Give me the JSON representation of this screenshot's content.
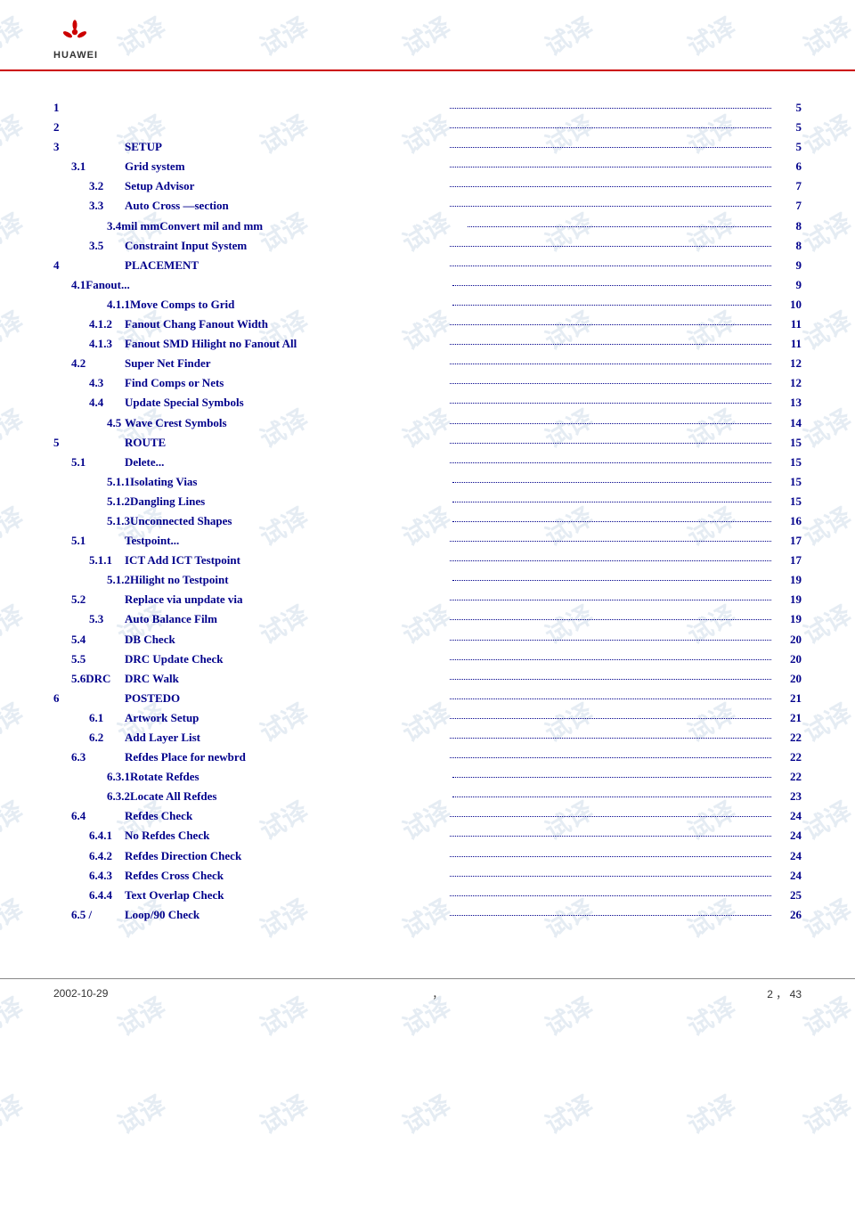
{
  "header": {
    "logo_text": "HUAWEI",
    "logo_alt": "Huawei logo"
  },
  "toc": {
    "entries": [
      {
        "number": "1",
        "title": "",
        "dots": true,
        "page": "5",
        "indent": 1
      },
      {
        "number": "2",
        "title": "",
        "dots": true,
        "page": "5",
        "indent": 1
      },
      {
        "number": "3",
        "title": "SETUP",
        "dots": true,
        "page": "5",
        "indent": 1
      },
      {
        "number": "3.1",
        "title": "Grid system",
        "dots": true,
        "page": "6",
        "indent": 2
      },
      {
        "number": "3.2",
        "title": "Setup Advisor",
        "dots": true,
        "page": "7",
        "indent": 3
      },
      {
        "number": "3.3",
        "title": "Auto Cross —section",
        "dots": true,
        "page": "7",
        "indent": 3
      },
      {
        "number": "3.4mil  mm",
        "title": "Convert mil and mm",
        "dots": true,
        "page": "8",
        "indent": 4
      },
      {
        "number": "3.5",
        "title": "Constraint Input System",
        "dots": true,
        "page": "8",
        "indent": 3
      },
      {
        "number": "4",
        "title": "PLACEMENT",
        "dots": true,
        "page": "9",
        "indent": 1
      },
      {
        "number": "4.1Fanout...",
        "title": "",
        "dots": true,
        "page": "9",
        "indent": 2
      },
      {
        "number": "4.1.1",
        "title": "Move Comps to Grid",
        "dots": true,
        "page": "10",
        "indent": 4
      },
      {
        "number": "4.1.2",
        "title": "Fanout   Chang Fanout Width",
        "dots": true,
        "page": "11",
        "indent": 3
      },
      {
        "number": "4.1.3",
        "title": "Fanout SMD Hilight no Fanout All",
        "dots": true,
        "page": "11",
        "indent": 3
      },
      {
        "number": "4.2",
        "title": "Super Net Finder",
        "dots": true,
        "page": "12",
        "indent": 2
      },
      {
        "number": "4.3",
        "title": "Find Comps or Nets",
        "dots": true,
        "page": "12",
        "indent": 3
      },
      {
        "number": "4.4",
        "title": "Update Special Symbols",
        "dots": true,
        "page": "13",
        "indent": 3
      },
      {
        "number": "4.5",
        "title": "Wave Crest Symbols",
        "dots": true,
        "page": "14",
        "indent": 4
      },
      {
        "number": "5",
        "title": "ROUTE",
        "dots": true,
        "page": "15",
        "indent": 1
      },
      {
        "number": "5.1",
        "title": "Delete...",
        "dots": true,
        "page": "15",
        "indent": 2
      },
      {
        "number": "5.1.1",
        "title": "Isolating Vias",
        "dots": true,
        "page": "15",
        "indent": 4
      },
      {
        "number": "5.1.2",
        "title": "Dangling Lines",
        "dots": true,
        "page": "15",
        "indent": 4
      },
      {
        "number": "5.1.3",
        "title": "Unconnected Shapes",
        "dots": true,
        "page": "16",
        "indent": 4
      },
      {
        "number": "5.1",
        "title": "Testpoint...",
        "dots": true,
        "page": "17",
        "indent": 2
      },
      {
        "number": "5.1.1",
        "title": "ICT    Add ICT Testpoint",
        "dots": true,
        "page": "17",
        "indent": 3
      },
      {
        "number": "5.1.2",
        "title": "Hilight no Testpoint",
        "dots": true,
        "page": "19",
        "indent": 4
      },
      {
        "number": "5.2",
        "title": "Replace via  unpdate via",
        "dots": true,
        "page": "19",
        "indent": 2
      },
      {
        "number": "5.3",
        "title": "Auto Balance Film",
        "dots": true,
        "page": "19",
        "indent": 3
      },
      {
        "number": "5.4",
        "title": "DB Check",
        "dots": true,
        "page": "20",
        "indent": 2
      },
      {
        "number": "5.5",
        "title": "DRC Update Check",
        "dots": true,
        "page": "20",
        "indent": 2
      },
      {
        "number": "5.6DRC",
        "title": "DRC Walk",
        "dots": true,
        "page": "20",
        "indent": 2
      },
      {
        "number": "6",
        "title": "POSTEDO",
        "dots": true,
        "page": "21",
        "indent": 1
      },
      {
        "number": "6.1",
        "title": "Artwork Setup",
        "dots": true,
        "page": "21",
        "indent": 3
      },
      {
        "number": "6.2",
        "title": "Add Layer List",
        "dots": true,
        "page": "22",
        "indent": 3
      },
      {
        "number": "6.3",
        "title": "Refdes Place for newbrd",
        "dots": true,
        "page": "22",
        "indent": 2
      },
      {
        "number": "6.3.1",
        "title": "Rotate Refdes",
        "dots": true,
        "page": "22",
        "indent": 4
      },
      {
        "number": "6.3.2",
        "title": "Locate All Refdes",
        "dots": true,
        "page": "23",
        "indent": 4
      },
      {
        "number": "6.4",
        "title": "Refdes Check",
        "dots": true,
        "page": "24",
        "indent": 2
      },
      {
        "number": "6.4.1",
        "title": "No Refdes Check",
        "dots": true,
        "page": "24",
        "indent": 3
      },
      {
        "number": "6.4.2",
        "title": "Refdes Direction  Check",
        "dots": true,
        "page": "24",
        "indent": 3
      },
      {
        "number": "6.4.3",
        "title": "Refdes Cross Check",
        "dots": true,
        "page": "24",
        "indent": 3
      },
      {
        "number": "6.4.4",
        "title": "Text Overlap Check",
        "dots": true,
        "page": "25",
        "indent": 3
      },
      {
        "number": "6.5   /",
        "title": "Loop/90 Check",
        "dots": true,
        "page": "26",
        "indent": 2
      }
    ]
  },
  "footer": {
    "left": "2002-10-29",
    "center": "，",
    "right": "2 ， 43"
  }
}
